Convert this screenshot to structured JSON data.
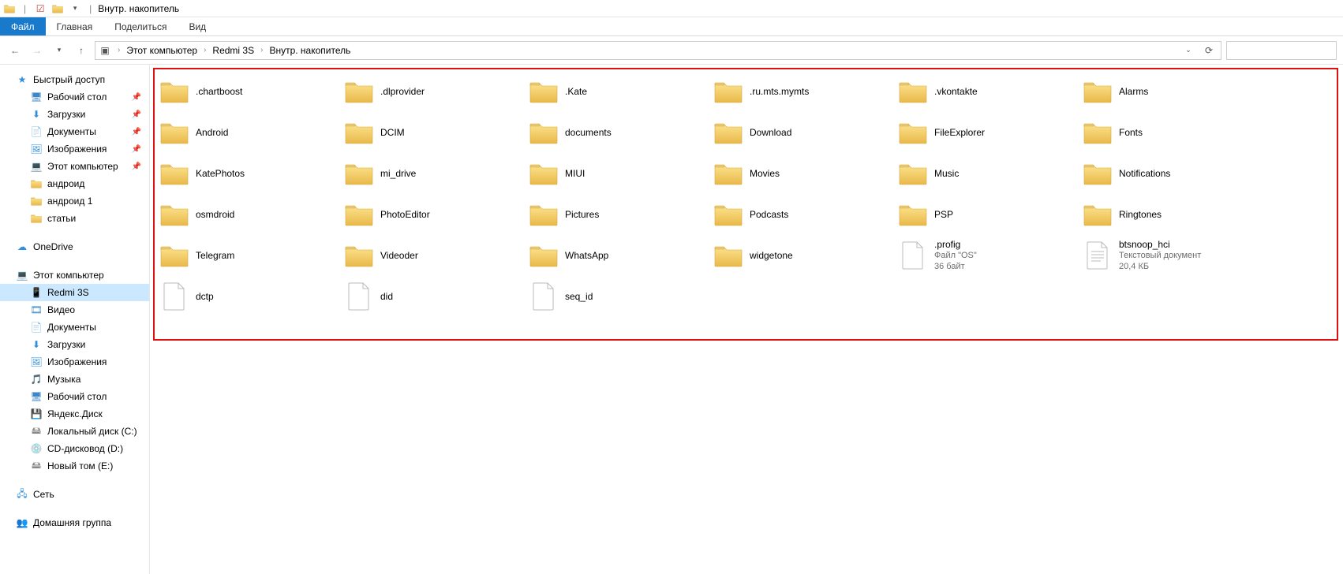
{
  "title_bar": {
    "window_title": "Внутр. накопитель"
  },
  "ribbon": {
    "file": "Файл",
    "home": "Главная",
    "share": "Поделиться",
    "view": "Вид"
  },
  "breadcrumbs": {
    "root": "Этот компьютер",
    "level1": "Redmi 3S",
    "level2": "Внутр. накопитель"
  },
  "search": {
    "placeholder": ""
  },
  "sidebar": {
    "quick_access": "Быстрый доступ",
    "desktop": "Рабочий стол",
    "downloads": "Загрузки",
    "documents": "Документы",
    "pictures": "Изображения",
    "this_pc_q": "Этот компьютер",
    "android": "андроид",
    "android1": "андроид 1",
    "articles": "статьи",
    "onedrive": "OneDrive",
    "this_pc": "Этот компьютер",
    "redmi": "Redmi 3S",
    "video": "Видео",
    "documents2": "Документы",
    "downloads2": "Загрузки",
    "pictures2": "Изображения",
    "music": "Музыка",
    "desktop2": "Рабочий стол",
    "yandex": "Яндекс.Диск",
    "local_c": "Локальный диск (C:)",
    "cd_d": "CD-дисковод (D:)",
    "new_e": "Новый том (E:)",
    "network": "Сеть",
    "homegroup": "Домашняя группа"
  },
  "items": [
    {
      "name": ".chartboost",
      "type": "folder"
    },
    {
      "name": ".dlprovider",
      "type": "folder"
    },
    {
      "name": ".Kate",
      "type": "folder"
    },
    {
      "name": ".ru.mts.mymts",
      "type": "folder"
    },
    {
      "name": ".vkontakte",
      "type": "folder"
    },
    {
      "name": "Alarms",
      "type": "folder"
    },
    {
      "name": "Android",
      "type": "folder"
    },
    {
      "name": "DCIM",
      "type": "folder"
    },
    {
      "name": "documents",
      "type": "folder"
    },
    {
      "name": "Download",
      "type": "folder"
    },
    {
      "name": "FileExplorer",
      "type": "folder"
    },
    {
      "name": "Fonts",
      "type": "folder"
    },
    {
      "name": "KatePhotos",
      "type": "folder"
    },
    {
      "name": "mi_drive",
      "type": "folder"
    },
    {
      "name": "MIUI",
      "type": "folder"
    },
    {
      "name": "Movies",
      "type": "folder"
    },
    {
      "name": "Music",
      "type": "folder"
    },
    {
      "name": "Notifications",
      "type": "folder"
    },
    {
      "name": "osmdroid",
      "type": "folder"
    },
    {
      "name": "PhotoEditor",
      "type": "folder"
    },
    {
      "name": "Pictures",
      "type": "folder"
    },
    {
      "name": "Podcasts",
      "type": "folder"
    },
    {
      "name": "PSP",
      "type": "folder"
    },
    {
      "name": "Ringtones",
      "type": "folder"
    },
    {
      "name": "Telegram",
      "type": "folder"
    },
    {
      "name": "Videoder",
      "type": "folder"
    },
    {
      "name": "WhatsApp",
      "type": "folder"
    },
    {
      "name": "widgetone",
      "type": "folder"
    },
    {
      "name": ".profig",
      "type": "file",
      "sub1": "Файл \"OS\"",
      "sub2": "36 байт"
    },
    {
      "name": "btsnoop_hci",
      "type": "textfile",
      "sub1": "Текстовый документ",
      "sub2": "20,4 КБ"
    },
    {
      "name": "dctp",
      "type": "file"
    },
    {
      "name": "did",
      "type": "file"
    },
    {
      "name": "seq_id",
      "type": "file"
    }
  ]
}
